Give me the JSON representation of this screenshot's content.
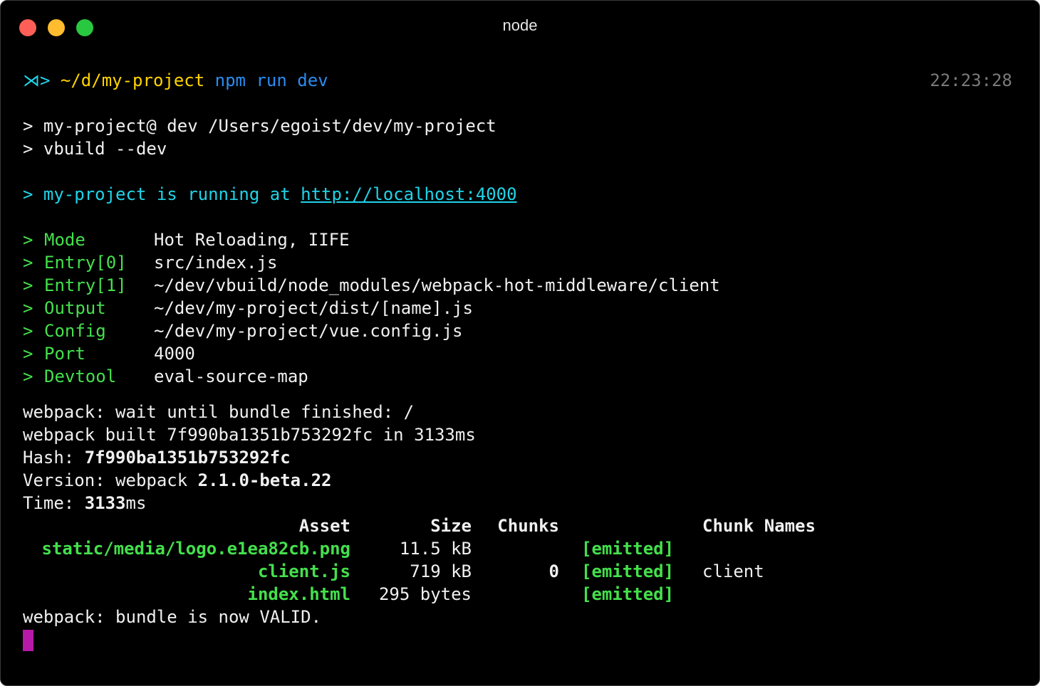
{
  "window": {
    "title": "node",
    "colors": {
      "background": "#000000",
      "close": "#ff5f57",
      "minimize": "#febc2e",
      "maximize": "#28c840"
    }
  },
  "prompt": {
    "symbol": "⋊>",
    "path": "~/d/my-project",
    "command": "npm",
    "args": "run dev",
    "time": "22:23:28"
  },
  "npm": {
    "line1": "> my-project@ dev /Users/egoist/dev/my-project",
    "line2": "> vbuild --dev"
  },
  "running": {
    "prefix": "> my-project is running at ",
    "url": "http://localhost:4000"
  },
  "info": [
    {
      "key": "Mode",
      "value": "Hot Reloading, IIFE"
    },
    {
      "key": "Entry[0]",
      "value": "src/index.js"
    },
    {
      "key": "Entry[1]",
      "value": "~/dev/vbuild/node_modules/webpack-hot-middleware/client"
    },
    {
      "key": "Output",
      "value": "~/dev/my-project/dist/[name].js"
    },
    {
      "key": "Config",
      "value": "~/dev/my-project/vue.config.js"
    },
    {
      "key": "Port",
      "value": "4000"
    },
    {
      "key": "Devtool",
      "value": "eval-source-map"
    }
  ],
  "info_prefix": ">",
  "webpack": {
    "wait": "webpack: wait until bundle finished: /",
    "built": "webpack built 7f990ba1351b753292fc in 3133ms",
    "hash_label": "Hash: ",
    "hash": "7f990ba1351b753292fc",
    "version_label": "Version: webpack ",
    "version": "2.1.0-beta.22",
    "time_label": "Time: ",
    "time": "3133",
    "time_unit": "ms",
    "valid": "webpack: bundle is now VALID."
  },
  "assets_table": {
    "headers": {
      "asset": "Asset",
      "size": "Size",
      "chunks": "Chunks",
      "chunk_names": "Chunk Names"
    },
    "rows": [
      {
        "asset": "static/media/logo.e1ea82cb.png",
        "size": "11.5 kB",
        "chunks": "",
        "status": "[emitted]",
        "chunk_names": ""
      },
      {
        "asset": "client.js",
        "size": "719 kB",
        "chunks": "0",
        "status": "[emitted]",
        "chunk_names": "client"
      },
      {
        "asset": "index.html",
        "size": "295 bytes",
        "chunks": "",
        "status": "[emitted]",
        "chunk_names": ""
      }
    ]
  }
}
